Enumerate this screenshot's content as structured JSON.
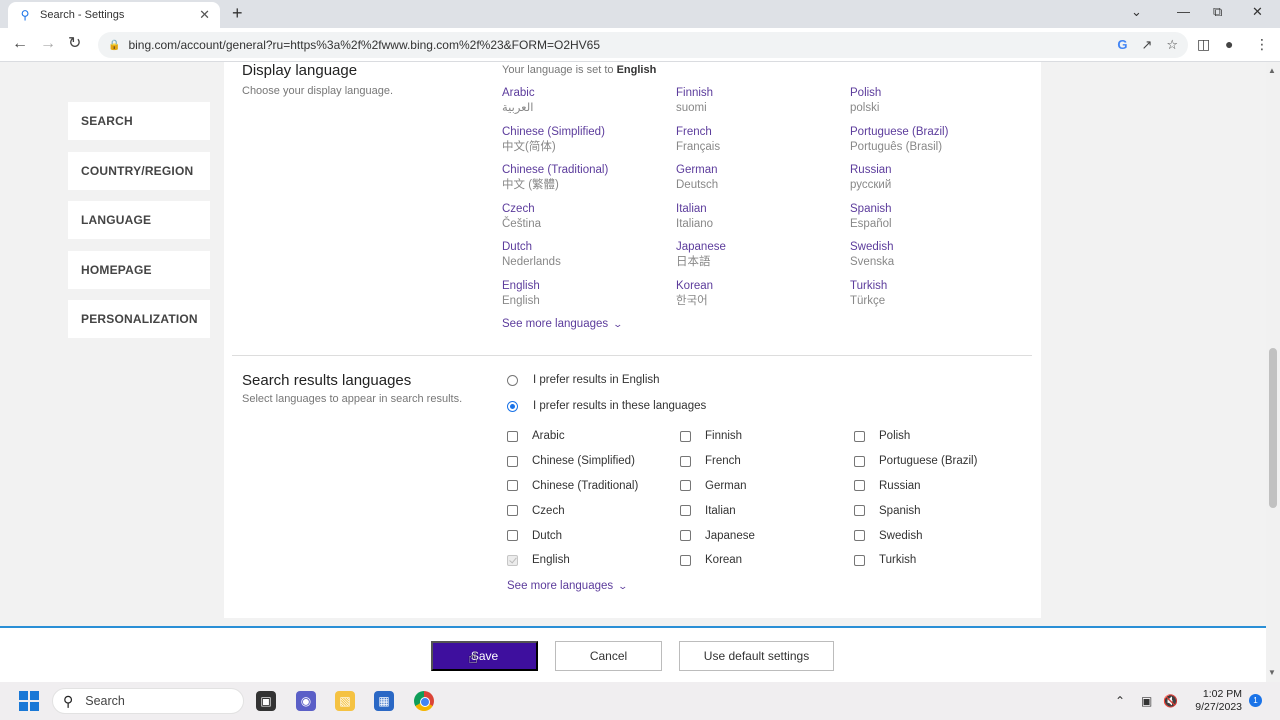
{
  "browser": {
    "tab_title": "Search - Settings",
    "url": "bing.com/account/general?ru=https%3a%2f%2fwww.bing.com%2f%23&FORM=O2HV65"
  },
  "sidebar": {
    "items": [
      {
        "label": "SEARCH"
      },
      {
        "label": "COUNTRY/REGION"
      },
      {
        "label": "LANGUAGE"
      },
      {
        "label": "HOMEPAGE"
      },
      {
        "label": "PERSONALIZATION"
      }
    ]
  },
  "display_language": {
    "title": "Display language",
    "subtitle": "Choose your display language.",
    "status_prefix": "Your language is set to",
    "status_value": "English",
    "columns": [
      [
        {
          "name": "Arabic",
          "native": "العربية"
        },
        {
          "name": "Chinese (Simplified)",
          "native": "中文(简体)"
        },
        {
          "name": "Chinese (Traditional)",
          "native": "中文 (繁體)"
        },
        {
          "name": "Czech",
          "native": "Čeština"
        },
        {
          "name": "Dutch",
          "native": "Nederlands"
        },
        {
          "name": "English",
          "native": "English"
        }
      ],
      [
        {
          "name": "Finnish",
          "native": "suomi"
        },
        {
          "name": "French",
          "native": "Français"
        },
        {
          "name": "German",
          "native": "Deutsch"
        },
        {
          "name": "Italian",
          "native": "Italiano"
        },
        {
          "name": "Japanese",
          "native": "日本語"
        },
        {
          "name": "Korean",
          "native": "한국어"
        }
      ],
      [
        {
          "name": "Polish",
          "native": "polski"
        },
        {
          "name": "Portuguese (Brazil)",
          "native": "Português (Brasil)"
        },
        {
          "name": "Russian",
          "native": "русский"
        },
        {
          "name": "Spanish",
          "native": "Español"
        },
        {
          "name": "Swedish",
          "native": "Svenska"
        },
        {
          "name": "Turkish",
          "native": "Türkçe"
        }
      ]
    ],
    "see_more": "See more languages"
  },
  "search_results_languages": {
    "title": "Search results languages",
    "subtitle": "Select languages to appear in search results.",
    "radio_english": "I prefer results in English",
    "radio_these": "I prefer results in these languages",
    "selected_option": "these",
    "columns": [
      [
        {
          "label": "Arabic",
          "checked": false,
          "disabled": false
        },
        {
          "label": "Chinese (Simplified)",
          "checked": false,
          "disabled": false
        },
        {
          "label": "Chinese (Traditional)",
          "checked": false,
          "disabled": false
        },
        {
          "label": "Czech",
          "checked": false,
          "disabled": false
        },
        {
          "label": "Dutch",
          "checked": false,
          "disabled": false
        },
        {
          "label": "English",
          "checked": true,
          "disabled": true
        }
      ],
      [
        {
          "label": "Finnish",
          "checked": false,
          "disabled": false
        },
        {
          "label": "French",
          "checked": false,
          "disabled": false
        },
        {
          "label": "German",
          "checked": false,
          "disabled": false
        },
        {
          "label": "Italian",
          "checked": false,
          "disabled": false
        },
        {
          "label": "Japanese",
          "checked": false,
          "disabled": false
        },
        {
          "label": "Korean",
          "checked": false,
          "disabled": false
        }
      ],
      [
        {
          "label": "Polish",
          "checked": false,
          "disabled": false
        },
        {
          "label": "Portuguese (Brazil)",
          "checked": false,
          "disabled": false
        },
        {
          "label": "Russian",
          "checked": false,
          "disabled": false
        },
        {
          "label": "Spanish",
          "checked": false,
          "disabled": false
        },
        {
          "label": "Swedish",
          "checked": false,
          "disabled": false
        },
        {
          "label": "Turkish",
          "checked": false,
          "disabled": false
        }
      ]
    ],
    "see_more": "See more languages"
  },
  "actions": {
    "save": "Save",
    "cancel": "Cancel",
    "default": "Use default settings"
  },
  "taskbar": {
    "search_placeholder": "Search",
    "time": "1:02 PM",
    "date": "9/27/2023",
    "notification_count": "1"
  },
  "colors": {
    "link": "#5c3c9c",
    "primary_button": "#3e0f9e",
    "accent_border": "#2a8fd6"
  }
}
